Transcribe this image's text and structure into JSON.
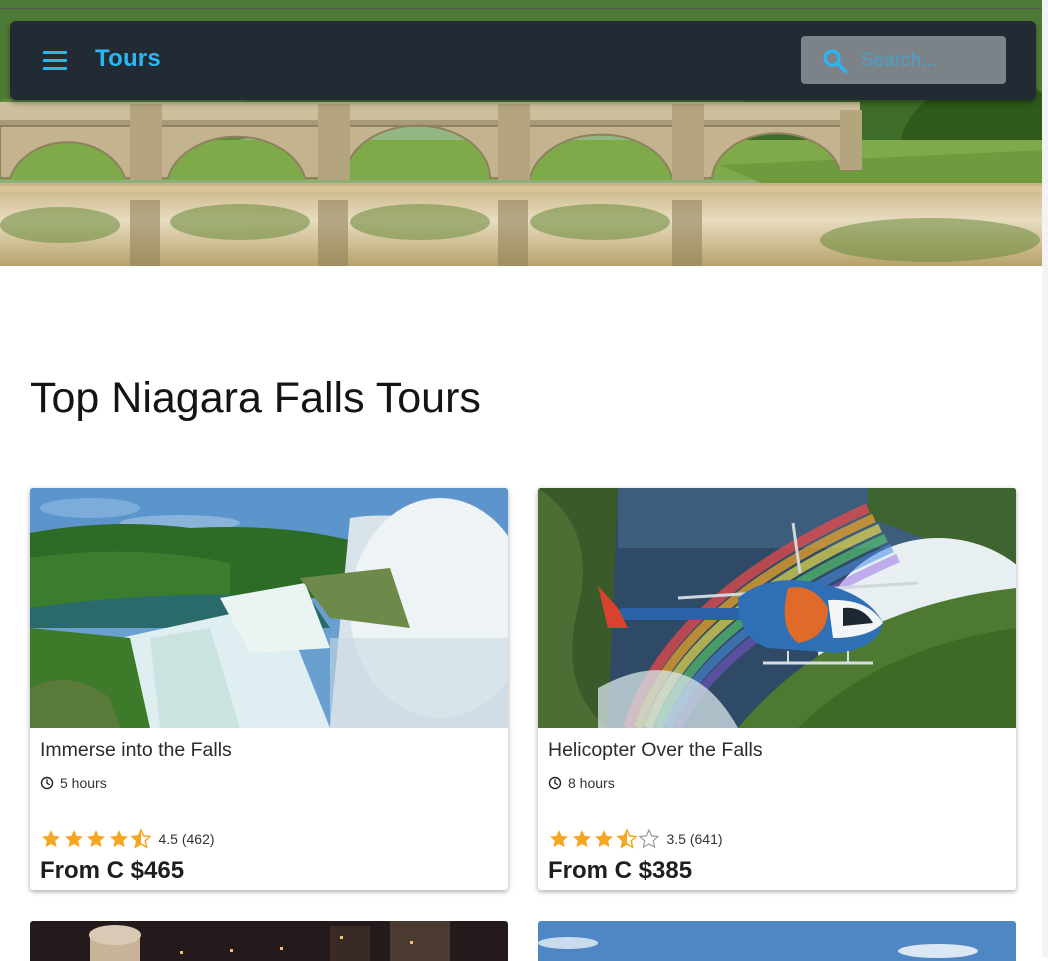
{
  "header": {
    "title": "Tours",
    "search_placeholder": "Search..."
  },
  "main": {
    "heading": "Top Niagara Falls Tours",
    "cards": [
      {
        "title": "Immerse into the Falls",
        "duration": "5 hours",
        "rating": 4.5,
        "rating_text": "4.5 (462)",
        "price": "From C $465"
      },
      {
        "title": "Helicopter Over the Falls",
        "duration": "8 hours",
        "rating": 3.5,
        "rating_text": "3.5 (641)",
        "price": "From C $385"
      }
    ]
  },
  "colors": {
    "appbar_bg": "#222b33",
    "accent": "#29b6f6",
    "star": "#f5a623",
    "star_empty": "#9e9e9e"
  },
  "icons": {
    "menu": "menu-icon",
    "search": "search-icon",
    "clock": "clock-icon",
    "star": "star-icon"
  }
}
